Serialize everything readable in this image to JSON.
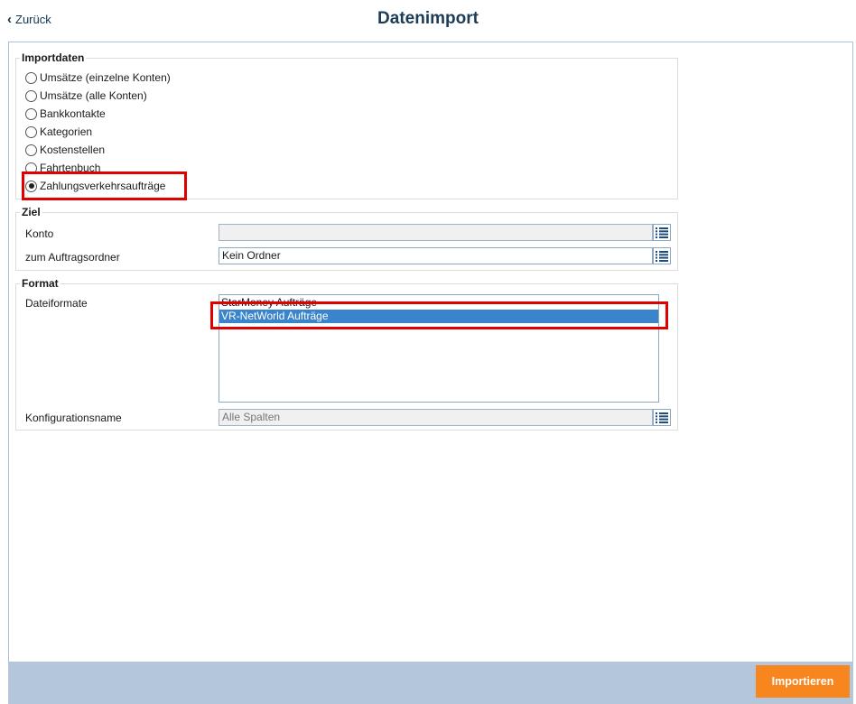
{
  "header": {
    "back_label": "Zurück",
    "title": "Datenimport"
  },
  "importdaten": {
    "legend": "Importdaten",
    "options": [
      {
        "label": "Umsätze (einzelne Konten)",
        "checked": false
      },
      {
        "label": "Umsätze (alle Konten)",
        "checked": false
      },
      {
        "label": "Bankkontakte",
        "checked": false
      },
      {
        "label": "Kategorien",
        "checked": false
      },
      {
        "label": "Kostenstellen",
        "checked": false
      },
      {
        "label": "Fahrtenbuch",
        "checked": false
      },
      {
        "label": "Zahlungsverkehrsaufträge",
        "checked": true
      }
    ]
  },
  "ziel": {
    "legend": "Ziel",
    "konto_label": "Konto",
    "konto_value": "",
    "ordner_label": "zum Auftragsordner",
    "ordner_value": "Kein Ordner"
  },
  "format": {
    "legend": "Format",
    "dateiformate_label": "Dateiformate",
    "dateiformate": [
      {
        "label": "StarMoney Aufträge",
        "selected": false
      },
      {
        "label": "VR-NetWorld Aufträge",
        "selected": true
      }
    ],
    "konfig_label": "Konfigurationsname",
    "konfig_value": "Alle Spalten"
  },
  "footer": {
    "import_label": "Importieren"
  },
  "colors": {
    "accent": "#f7861e",
    "title": "#1d3c57",
    "selection": "#3a84cc",
    "highlight": "#e00000",
    "footer_bar": "#b4c6dc"
  },
  "icons": {
    "back": "chevron-left-icon",
    "list_picker": "list-icon"
  }
}
